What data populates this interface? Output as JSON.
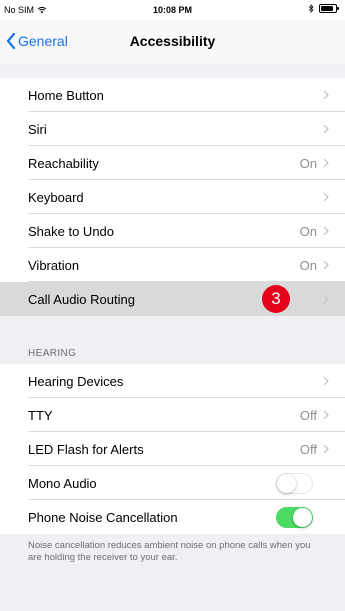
{
  "status_bar": {
    "carrier": "No SIM",
    "time": "10:08 PM",
    "battery_level": 0.85
  },
  "nav": {
    "back_label": "General",
    "title": "Accessibility"
  },
  "rows_top": [
    {
      "label": "Home Button",
      "value": ""
    },
    {
      "label": "Siri",
      "value": ""
    },
    {
      "label": "Reachability",
      "value": "On"
    },
    {
      "label": "Keyboard",
      "value": ""
    },
    {
      "label": "Shake to Undo",
      "value": "On"
    },
    {
      "label": "Vibration",
      "value": "On"
    },
    {
      "label": "Call Audio Routing",
      "value": "",
      "badge": "3"
    }
  ],
  "hearing": {
    "header": "HEARING",
    "rows": [
      {
        "label": "Hearing Devices",
        "value": ""
      },
      {
        "label": "TTY",
        "value": "Off"
      },
      {
        "label": "LED Flash for Alerts",
        "value": "Off"
      },
      {
        "label": "Mono Audio",
        "toggle": false
      },
      {
        "label": "Phone Noise Cancellation",
        "toggle": true
      }
    ],
    "footer": "Noise cancellation reduces ambient noise on phone calls when you are holding the receiver to your ear."
  },
  "colors": {
    "accent": "#1a73e8",
    "toggle_on": "#4cd964",
    "badge": "#e3001b",
    "group_background": "#efeff4"
  }
}
